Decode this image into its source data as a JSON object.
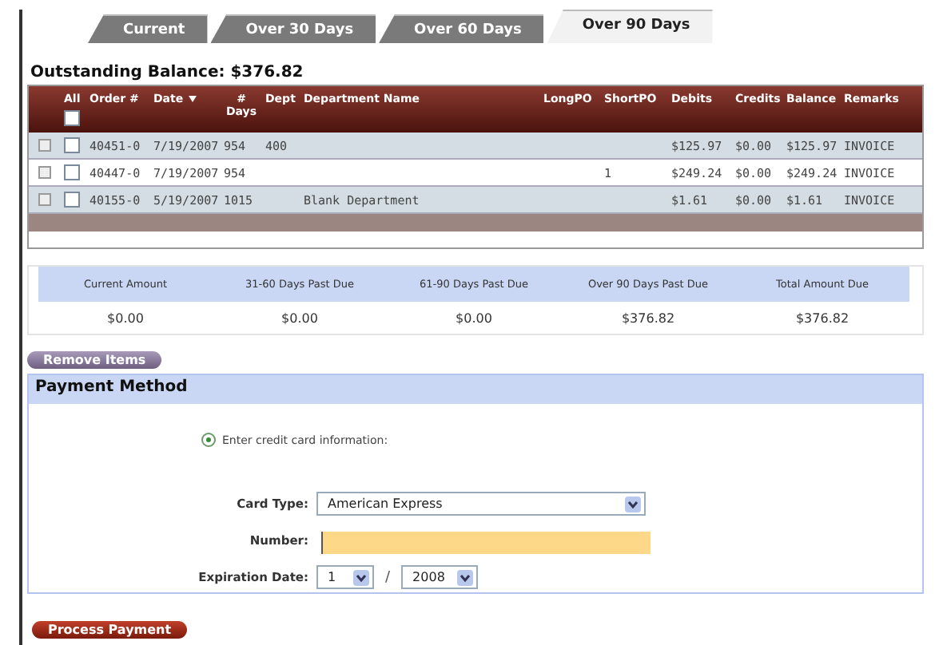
{
  "tabs": [
    {
      "label": "Current",
      "selected": false
    },
    {
      "label": "Over 30 Days",
      "selected": false
    },
    {
      "label": "Over 60 Days",
      "selected": false
    },
    {
      "label": "Over 90 Days",
      "selected": true
    }
  ],
  "outstanding_balance": "Outstanding Balance: $376.82",
  "table": {
    "select_all_label": "All",
    "columns": [
      "Order #",
      "Date",
      "# Days",
      "Dept",
      "Department Name",
      "LongPO",
      "ShortPO",
      "Debits",
      "Credits",
      "Balance",
      "Remarks"
    ],
    "select_all_checked": false,
    "rows": [
      {
        "checked": false,
        "cells": [
          "40451-0",
          "7/19/2007",
          "954",
          "400",
          "",
          "",
          "",
          "$125.97",
          "$0.00",
          "$125.97",
          "INVOICE"
        ]
      },
      {
        "checked": false,
        "cells": [
          "40447-0",
          "7/19/2007",
          "954",
          "",
          "",
          "",
          "1",
          "$249.24",
          "$0.00",
          "$249.24",
          "INVOICE"
        ]
      },
      {
        "checked": false,
        "cells": [
          "40155-0",
          "5/19/2007",
          "1015",
          "",
          "Blank Department",
          "",
          "",
          "$1.61",
          "$0.00",
          "$1.61",
          "INVOICE"
        ]
      }
    ]
  },
  "summary": [
    {
      "label": "Current Amount",
      "value": "$0.00"
    },
    {
      "label": "31-60 Days Past Due",
      "value": "$0.00"
    },
    {
      "label": "61-90 Days Past Due",
      "value": "$0.00"
    },
    {
      "label": "Over 90 Days Past Due",
      "value": "$376.82"
    },
    {
      "label": "Total Amount Due",
      "value": "$376.82"
    }
  ],
  "remove_button": "Remove Items",
  "payment": {
    "title": "Payment Method",
    "option": {
      "label": "Enter credit card information:",
      "selected": true
    },
    "card_type": {
      "label": "Card Type:",
      "value": "American Express"
    },
    "number": {
      "label": "Number:"
    },
    "expiration": {
      "label": "Expiration Date:",
      "month": "1",
      "separator": "/",
      "year": "2008"
    }
  },
  "process_button": "Process Payment"
}
